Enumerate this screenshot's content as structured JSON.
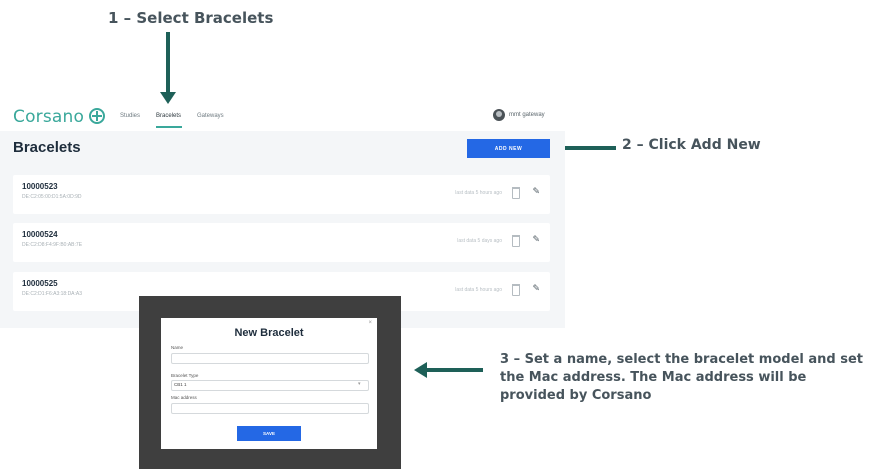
{
  "annotations": {
    "step1": "1 – Select Bracelets",
    "step2": "2 – Click Add New",
    "step3": "3 – Set a name,  select the bracelet model and set the Mac address. The Mac address will be provided by Corsano"
  },
  "app": {
    "logo": "Corsano",
    "nav": {
      "studies": "Studies",
      "bracelets": "Bracelets",
      "gateways": "Gateways"
    },
    "user": "mmt gateway"
  },
  "page": {
    "title": "Bracelets",
    "add_new_label": "ADD NEW",
    "bracelets": [
      {
        "id": "10000523",
        "mac": "DE:C2:05:00:D1:5A:0D:9D",
        "last_seen": "last data 5 hours ago"
      },
      {
        "id": "10000524",
        "mac": "DE:C2:D8:F4:9F:B0:AB:7E",
        "last_seen": "last data 5 days ago"
      },
      {
        "id": "10000525",
        "mac": "DE:C2:D1:F6:A3:18:DA:A3",
        "last_seen": "last data 5 hours ago"
      }
    ]
  },
  "modal": {
    "close": "×",
    "title": "New Bracelet",
    "name_label": "Name",
    "type_label": "Bracelet Type",
    "type_value": "CB1 1",
    "mac_label": "Mac address",
    "save_label": "SAVE"
  },
  "colors": {
    "accent": "#2468e5",
    "brand": "#3aa89b",
    "annotation": "#47545c",
    "arrow": "#1e6058"
  }
}
